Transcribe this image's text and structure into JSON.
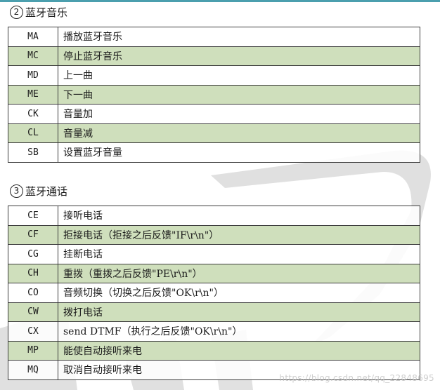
{
  "sections": [
    {
      "number": "2",
      "title": "蓝牙音乐",
      "rows": [
        {
          "code": "MA",
          "desc": "播放蓝牙音乐"
        },
        {
          "code": "MC",
          "desc": "停止蓝牙音乐"
        },
        {
          "code": "MD",
          "desc": "上一曲"
        },
        {
          "code": "ME",
          "desc": "下一曲"
        },
        {
          "code": "CK",
          "desc": "音量加"
        },
        {
          "code": "CL",
          "desc": "音量减"
        },
        {
          "code": "SB",
          "desc": "设置蓝牙音量"
        }
      ]
    },
    {
      "number": "3",
      "title": "蓝牙通话",
      "rows": [
        {
          "code": "CE",
          "desc": "接听电话"
        },
        {
          "code": "CF",
          "desc": "拒接电话（拒接之后反馈\"IF\\r\\n\"）"
        },
        {
          "code": "CG",
          "desc": "挂断电话"
        },
        {
          "code": "CH",
          "desc": "重拨（重拨之后反馈\"PE\\r\\n\"）"
        },
        {
          "code": "CO",
          "desc": "音频切换（切换之后反馈\"OK\\r\\n\"）"
        },
        {
          "code": "CW",
          "desc": "拨打电话"
        },
        {
          "code": "CX",
          "desc": "send DTMF（执行之后反馈\"OK\\r\\n\"）"
        },
        {
          "code": "MP",
          "desc": "能使自动接听来电"
        },
        {
          "code": "MQ",
          "desc": "取消自动接听来电"
        }
      ]
    }
  ],
  "watermark": "https://blog.csdn.net/qq_22848695",
  "colors": {
    "shaded_row": "#cfdfbc",
    "top_rule": "#4b9fae",
    "border": "#3c3c3c"
  }
}
